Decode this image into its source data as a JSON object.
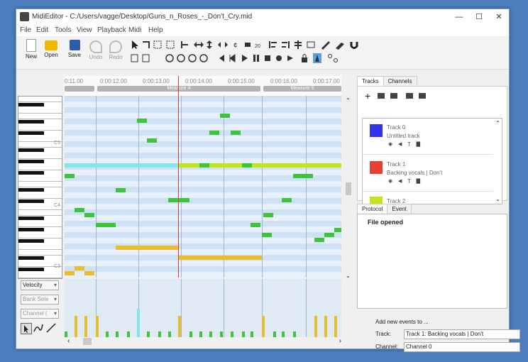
{
  "window": {
    "title": "MidiEditor - C:/Users/vagge/Desktop/Guns_n_Roses_-_Don't_Cry.mid",
    "min": "—",
    "max": "☐",
    "close": "✕"
  },
  "menu": [
    "File",
    "Edit",
    "Tools",
    "View",
    "Playback",
    "Midi",
    "Help"
  ],
  "toolbar": {
    "new": "New",
    "open": "Open",
    "save": "Save",
    "undo": "Undo",
    "redo": "Redo"
  },
  "ruler": {
    "times": [
      "0:11.00",
      "0:00:12.00",
      "0:00:13.00",
      "0:00:14.00",
      "0:00:15.00",
      "0:00:16.00",
      "0:00:17.00"
    ],
    "measures": [
      "Measure 4",
      "Measure 5"
    ]
  },
  "piano": {
    "octaves": [
      "C5",
      "C4",
      "C3"
    ]
  },
  "lower_left": {
    "velocity": "Velocity",
    "bank_select": "Bank Sele",
    "channel": "Channel ("
  },
  "right": {
    "tabs": [
      "Tracks",
      "Channels"
    ],
    "tracks": [
      {
        "name": "Track 0",
        "sub": "Untitled track",
        "color": "#3333e6"
      },
      {
        "name": "Track 1",
        "sub": "Backing vocals | Don't",
        "color": "#e64033"
      },
      {
        "name": "Track 2",
        "sub": "",
        "color": "#c0e61a"
      }
    ],
    "log_tabs": [
      "Protocol",
      "Event"
    ],
    "log_entry": "File opened",
    "add_events": "Add new events to ...",
    "track_label": "Track:",
    "track_value": "Track 1: Backing vocals | Don't",
    "channel_label": "Channel:",
    "channel_value": "Channel 0"
  },
  "colors": {
    "green": "#3cc43a",
    "yellow": "#e6be2e",
    "cyan": "#80e6e6",
    "lime": "#c0e61a"
  }
}
